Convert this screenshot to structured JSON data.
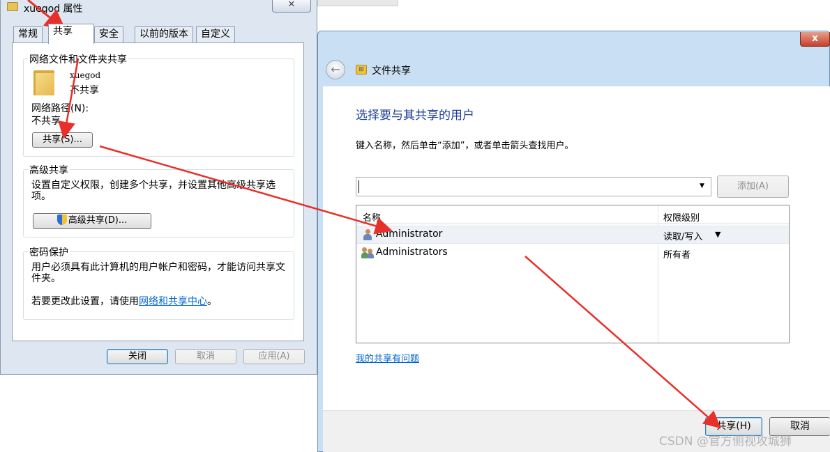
{
  "properties_dialog": {
    "title": "xuegod 属性",
    "close_glyph": "✕",
    "tabs": [
      "常规",
      "共享",
      "安全",
      "以前的版本",
      "自定义"
    ],
    "network_sharing": {
      "group_title": "网络文件和文件夹共享",
      "folder_name": "xuegod",
      "folder_status": "不共享",
      "network_path_label": "网络路径(N):",
      "network_path_value": "不共享",
      "share_button": "共享(S)..."
    },
    "advanced_sharing": {
      "group_title": "高级共享",
      "description": "设置自定义权限，创建多个共享，并设置其他高级共享选项。",
      "button": "高级共享(D)..."
    },
    "password_protection": {
      "group_title": "密码保护",
      "description": "用户必须具有此计算机的用户帐户和密码，才能访问共享文件夹。",
      "change_prefix": "若要更改此设置，请使用",
      "change_link": "网络和共享中心",
      "change_suffix": "。"
    },
    "buttons": {
      "close": "关闭",
      "cancel": "取消",
      "apply": "应用(A)"
    }
  },
  "file_sharing_window": {
    "title": "文件共享",
    "close_glyph": "x",
    "back_glyph": "←",
    "heading": "选择要与其共享的用户",
    "instruction": "键入名称，然后单击“添加”，或者单击箭头查找用户。",
    "combo_value": "",
    "add_button": "添加(A)",
    "columns": {
      "name": "名称",
      "permission": "权限级别"
    },
    "users": [
      {
        "name": "Administrator",
        "permission": "读取/写入",
        "icon": "user-icon",
        "selected": true,
        "has_dropdown": true
      },
      {
        "name": "Administrators",
        "permission": "所有者",
        "icon": "users-group-icon",
        "selected": false,
        "has_dropdown": false
      }
    ],
    "problem_link": "我的共享有问题",
    "share_button": "共享(H)",
    "cancel_button": "取消"
  },
  "watermark": "CSDN @官方侧视攻城狮",
  "colors": {
    "annotation_arrow": "#e8302a",
    "heading_blue": "#1e3f9c",
    "link_blue": "#0066cc"
  }
}
